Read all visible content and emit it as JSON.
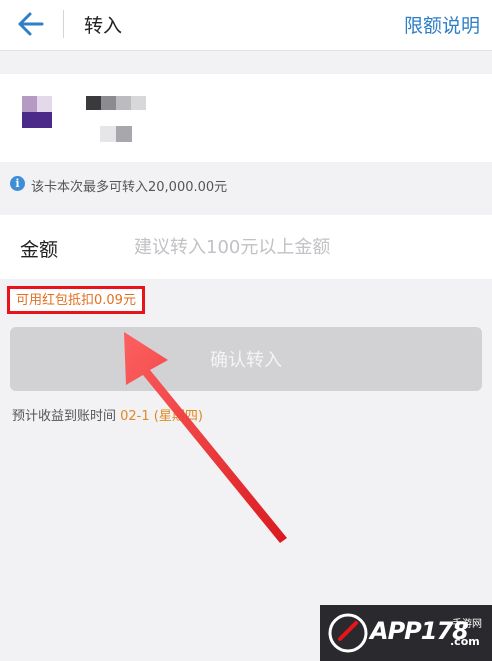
{
  "header": {
    "back_icon": "back-arrow-icon",
    "title": "转入",
    "limit_link": "限额说明"
  },
  "card": {
    "logo_icon": "bank-logo-icon",
    "name_blurred": true,
    "number_blurred": true
  },
  "info": {
    "icon": "info-icon",
    "text": "该卡本次最多可转入20,000.00元"
  },
  "amount": {
    "label": "金额",
    "value": "",
    "placeholder": "建议转入100元以上金额"
  },
  "redpacket": {
    "text": "可用红包抵扣0.09元"
  },
  "confirm_button": {
    "label": "确认转入"
  },
  "arrival": {
    "prefix": "预计收益到账时间 ",
    "date": "02-1 (星期四)"
  },
  "watermark": {
    "logo_text": "APP178",
    "sub_text": "手游网",
    "domain_text": ".com"
  },
  "colors": {
    "accent": "#2f7fc7",
    "highlight_border": "#e8141a",
    "redpacket_text": "#e07020",
    "date_text": "#e08a20",
    "button_disabled": "#d2d2d4"
  }
}
